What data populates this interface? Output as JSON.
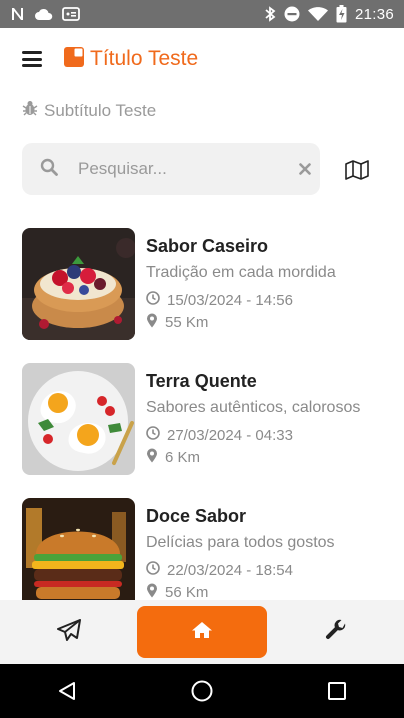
{
  "status_bar": {
    "time": "21:36",
    "icons": [
      "n-icon",
      "cloud-icon",
      "message-icon",
      "bluetooth-icon",
      "do-not-disturb-icon",
      "wifi-icon",
      "battery-icon"
    ]
  },
  "header": {
    "title": "Título Teste",
    "subtitle": "Subtítulo Teste",
    "accent_color": "#f06a1c"
  },
  "search": {
    "placeholder": "Pesquisar...",
    "value": ""
  },
  "items": [
    {
      "title": "Sabor Caseiro",
      "subtitle": "Tradição em cada mordida",
      "datetime": "15/03/2024 - 14:56",
      "distance": "55 Km",
      "image": "fruit-tart"
    },
    {
      "title": "Terra Quente",
      "subtitle": "Sabores autênticos, calorosos",
      "datetime": "27/03/2024 - 04:33",
      "distance": "6 Km",
      "image": "fried-eggs"
    },
    {
      "title": "Doce Sabor",
      "subtitle": "Delícias para todos gostos",
      "datetime": "22/03/2024 - 18:54",
      "distance": "56 Km",
      "image": "burger"
    }
  ],
  "bottom_nav": {
    "items": [
      "send-icon",
      "home-icon",
      "wrench-icon"
    ],
    "active": "home-icon",
    "active_color": "#f46c0e"
  },
  "system_nav": [
    "back-icon",
    "home-circle-icon",
    "recents-icon"
  ]
}
